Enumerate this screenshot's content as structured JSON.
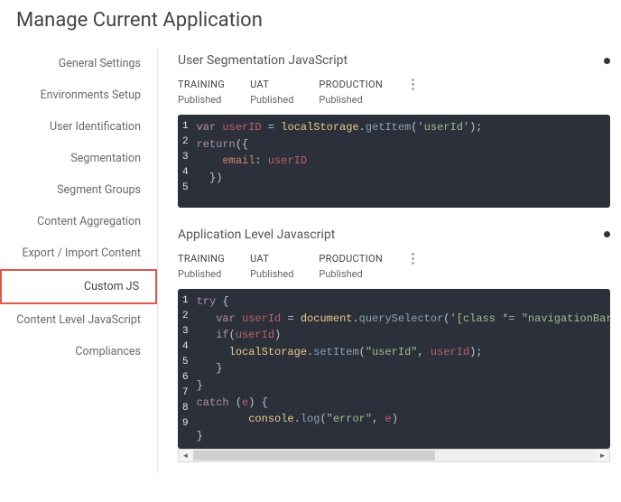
{
  "page_title": "Manage Current Application",
  "sidebar": {
    "items": [
      {
        "label": "General Settings"
      },
      {
        "label": "Environments Setup"
      },
      {
        "label": "User Identification"
      },
      {
        "label": "Segmentation"
      },
      {
        "label": "Segment Groups"
      },
      {
        "label": "Content Aggregation"
      },
      {
        "label": "Export / Import Content"
      },
      {
        "label": "Custom JS"
      },
      {
        "label": "Content Level JavaScript"
      },
      {
        "label": "Compliances"
      }
    ],
    "selected_index": 7
  },
  "sections": [
    {
      "title": "User Segmentation JavaScript",
      "envs": [
        {
          "name": "TRAINING",
          "status": "Published"
        },
        {
          "name": "UAT",
          "status": "Published"
        },
        {
          "name": "PRODUCTION",
          "status": "Published"
        }
      ],
      "code_lines": [
        [
          {
            "k": "kw",
            "t": "var "
          },
          {
            "k": "varname",
            "t": "userID"
          },
          {
            "k": "punct",
            "t": " = "
          },
          {
            "k": "obj",
            "t": "localStorage"
          },
          {
            "k": "punct",
            "t": "."
          },
          {
            "k": "method",
            "t": "getItem"
          },
          {
            "k": "punct",
            "t": "("
          },
          {
            "k": "str",
            "t": "'userId'"
          },
          {
            "k": "punct",
            "t": ");"
          }
        ],
        [
          {
            "k": "kw2",
            "t": "return"
          },
          {
            "k": "punct",
            "t": "({"
          }
        ],
        [
          {
            "k": "punct",
            "t": "    "
          },
          {
            "k": "prop",
            "t": "email"
          },
          {
            "k": "punct",
            "t": ": "
          },
          {
            "k": "varname",
            "t": "userID"
          }
        ],
        [
          {
            "k": "punct",
            "t": "  })"
          }
        ],
        []
      ],
      "line_count": 5
    },
    {
      "title": "Application Level Javascript",
      "envs": [
        {
          "name": "TRAINING",
          "status": "Published"
        },
        {
          "name": "UAT",
          "status": "Published"
        },
        {
          "name": "PRODUCTION",
          "status": "Published"
        }
      ],
      "code_lines": [
        [
          {
            "k": "kw",
            "t": "try"
          },
          {
            "k": "punct",
            "t": " {"
          }
        ],
        [
          {
            "k": "punct",
            "t": "   "
          },
          {
            "k": "kw",
            "t": "var "
          },
          {
            "k": "varname",
            "t": "userId"
          },
          {
            "k": "punct",
            "t": " = "
          },
          {
            "k": "obj",
            "t": "document"
          },
          {
            "k": "punct",
            "t": "."
          },
          {
            "k": "method",
            "t": "querySelector"
          },
          {
            "k": "punct",
            "t": "("
          },
          {
            "k": "str",
            "t": "'[class *= \"navigationBar-userFlyoutUserName"
          }
        ],
        [
          {
            "k": "punct",
            "t": "   "
          },
          {
            "k": "kw",
            "t": "if"
          },
          {
            "k": "punct",
            "t": "("
          },
          {
            "k": "varname",
            "t": "userId"
          },
          {
            "k": "punct",
            "t": ")"
          }
        ],
        [
          {
            "k": "punct",
            "t": "     "
          },
          {
            "k": "obj",
            "t": "localStorage"
          },
          {
            "k": "punct",
            "t": "."
          },
          {
            "k": "method",
            "t": "setItem"
          },
          {
            "k": "punct",
            "t": "("
          },
          {
            "k": "str",
            "t": "\"userId\""
          },
          {
            "k": "punct",
            "t": ", "
          },
          {
            "k": "varname",
            "t": "userId"
          },
          {
            "k": "punct",
            "t": ");"
          }
        ],
        [
          {
            "k": "punct",
            "t": "   }"
          }
        ],
        [
          {
            "k": "punct",
            "t": "}"
          }
        ],
        [
          {
            "k": "kw",
            "t": "catch"
          },
          {
            "k": "punct",
            "t": " ("
          },
          {
            "k": "varname",
            "t": "e"
          },
          {
            "k": "punct",
            "t": ") {"
          }
        ],
        [
          {
            "k": "punct",
            "t": "        "
          },
          {
            "k": "obj",
            "t": "console"
          },
          {
            "k": "punct",
            "t": "."
          },
          {
            "k": "method",
            "t": "log"
          },
          {
            "k": "punct",
            "t": "("
          },
          {
            "k": "str",
            "t": "\"error\""
          },
          {
            "k": "punct",
            "t": ", "
          },
          {
            "k": "varname",
            "t": "e"
          },
          {
            "k": "punct",
            "t": ")"
          }
        ],
        [
          {
            "k": "punct",
            "t": "}"
          }
        ]
      ],
      "line_count": 9,
      "has_h_scroll": true
    }
  ]
}
